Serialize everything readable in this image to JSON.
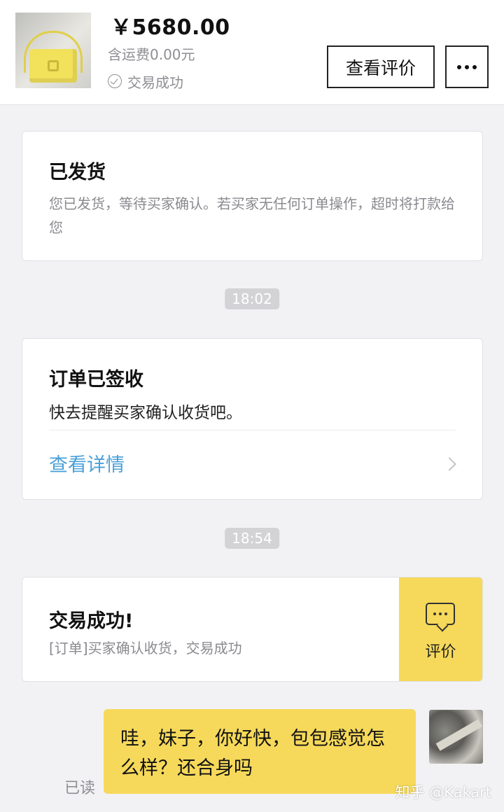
{
  "header": {
    "price": "￥5680.00",
    "shipping": "含运费0.00元",
    "status": "交易成功",
    "review_button": "查看评价"
  },
  "cards": {
    "shipped": {
      "title": "已发货",
      "desc": "您已发货，等待买家确认。若买家无任何订单操作，超时将打款给您"
    },
    "signed": {
      "title": "订单已签收",
      "body": "快去提醒买家确认收货吧。",
      "link": "查看详情"
    },
    "success": {
      "title": "交易成功!",
      "desc": "[订单]买家确认收货，交易成功",
      "rate_label": "评价"
    }
  },
  "timestamps": [
    "18:02",
    "18:54"
  ],
  "message": {
    "text": "哇，妹子，你好快，包包感觉怎么样？还合身吗",
    "read_status": "已读"
  },
  "watermark": "知乎 @Kakart",
  "colors": {
    "accent_yellow": "#f6d95a",
    "link_blue": "#4aa0d9",
    "background": "#f2f2f4"
  }
}
